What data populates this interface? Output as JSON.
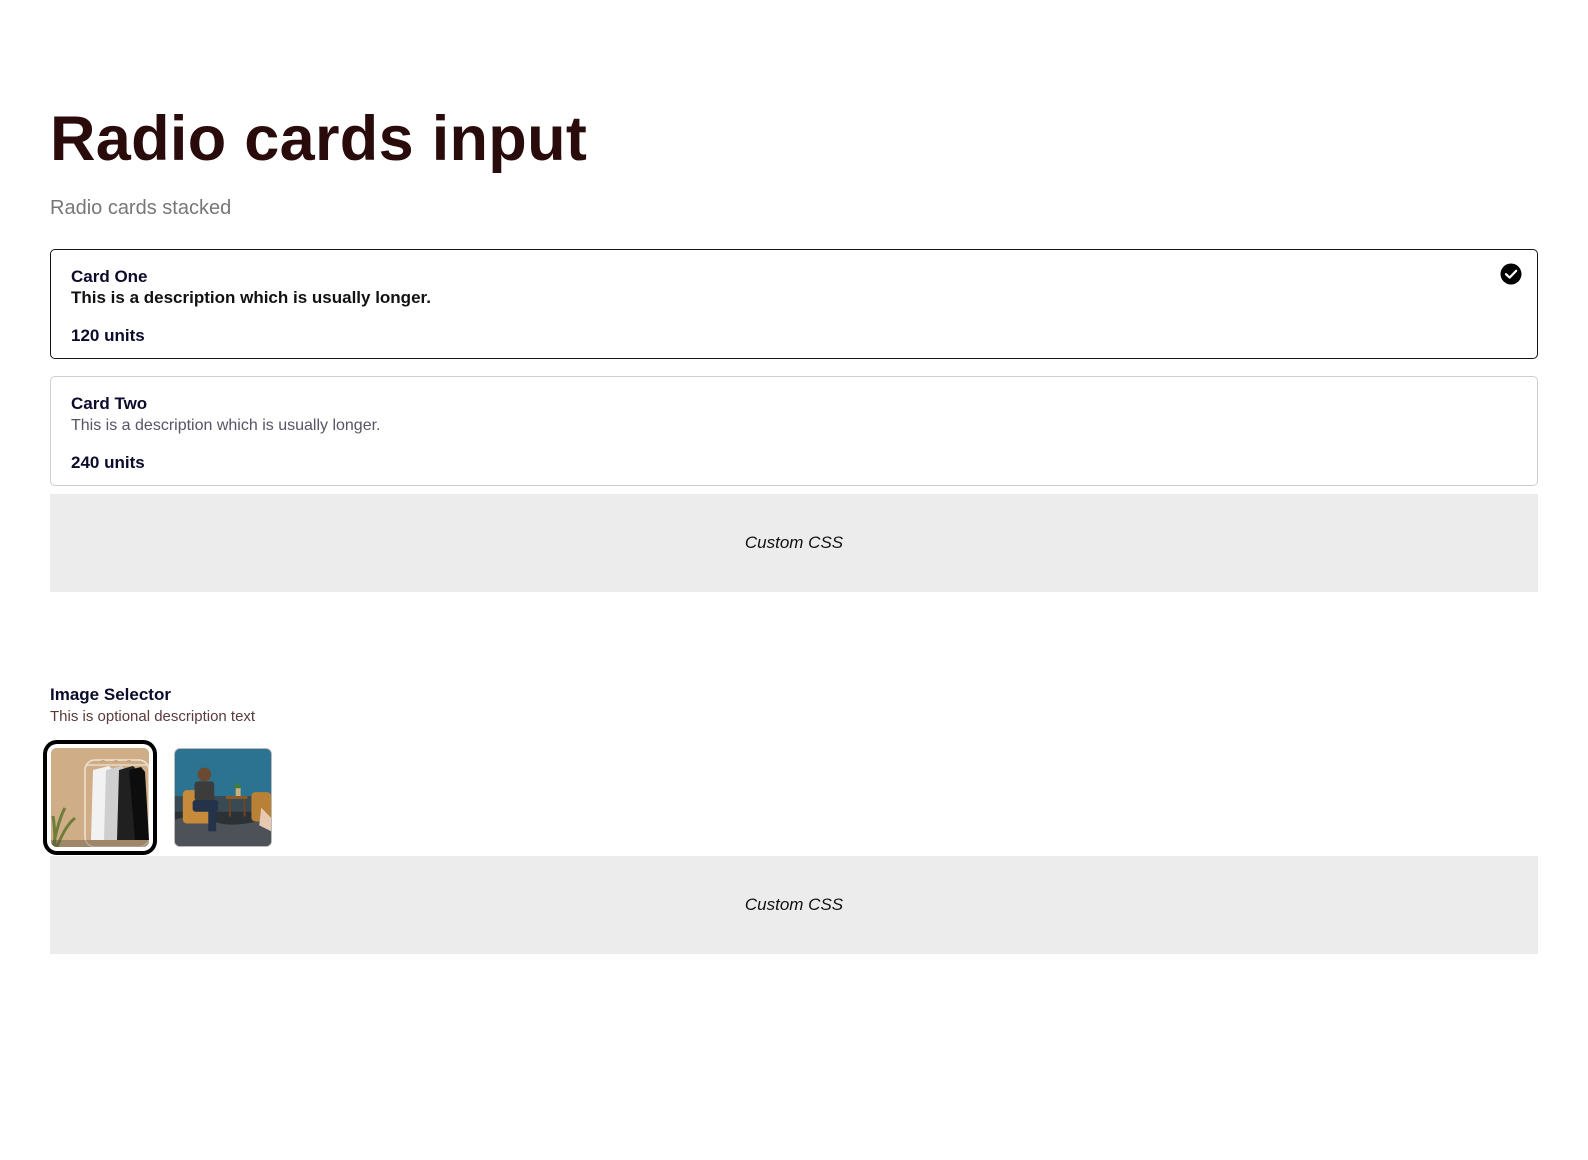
{
  "header": {
    "title": "Radio cards input",
    "subtitle": "Radio cards stacked"
  },
  "radio_cards": [
    {
      "title": "Card One",
      "description": "This is a description which is usually longer.",
      "units": "120 units",
      "selected": true
    },
    {
      "title": "Card Two",
      "description": "This is a description which is usually longer.",
      "units": "240 units",
      "selected": false
    }
  ],
  "custom_css_panels": [
    {
      "label": "Custom CSS"
    },
    {
      "label": "Custom CSS"
    }
  ],
  "image_selector": {
    "label": "Image Selector",
    "description": "This is optional description text",
    "options": [
      {
        "image": "clothes-rack-photo",
        "selected": true
      },
      {
        "image": "people-seated-photo",
        "selected": false
      }
    ]
  },
  "colors": {
    "title": "#2a0b0b",
    "selected_border": "#141414",
    "panel_bg": "#ececec"
  }
}
